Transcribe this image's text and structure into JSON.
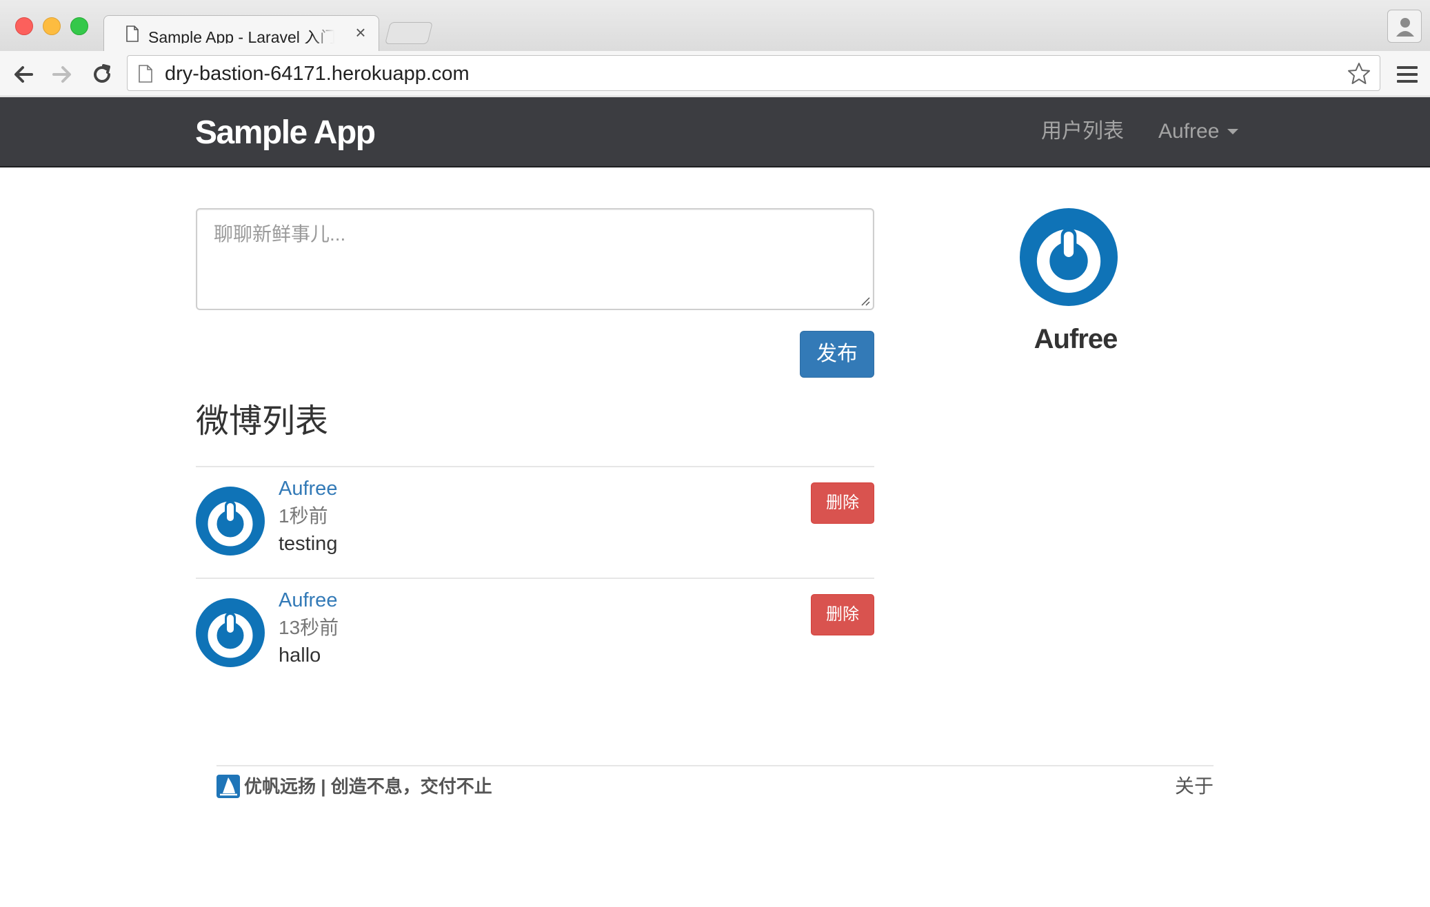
{
  "browser": {
    "tab_title": "Sample App - Laravel 入门教程",
    "tab_close": "×",
    "url": "dry-bastion-64171.herokuapp.com"
  },
  "navbar": {
    "brand": "Sample App",
    "users_link": "用户列表",
    "user_menu": "Aufree"
  },
  "compose": {
    "placeholder": "聊聊新鲜事儿...",
    "submit_label": "发布"
  },
  "feed": {
    "title": "微博列表",
    "statuses": [
      {
        "author": "Aufree",
        "time": "1秒前",
        "content": "testing",
        "delete_label": "删除"
      },
      {
        "author": "Aufree",
        "time": "13秒前",
        "content": "hallo",
        "delete_label": "删除"
      }
    ]
  },
  "sidebar": {
    "user_name": "Aufree"
  },
  "footer": {
    "text": "优帆远扬 | 创造不息，交付不止",
    "about": "关于"
  },
  "colors": {
    "navbar_bg": "#3c3d41",
    "link_blue": "#337ab7",
    "primary_button": "#337ab7",
    "danger_button": "#d9534f",
    "avatar_blue": "#0f73b7"
  },
  "icons": {
    "avatar": "gravatar-power-icon",
    "footer_logo": "sailboat-logo-icon"
  }
}
